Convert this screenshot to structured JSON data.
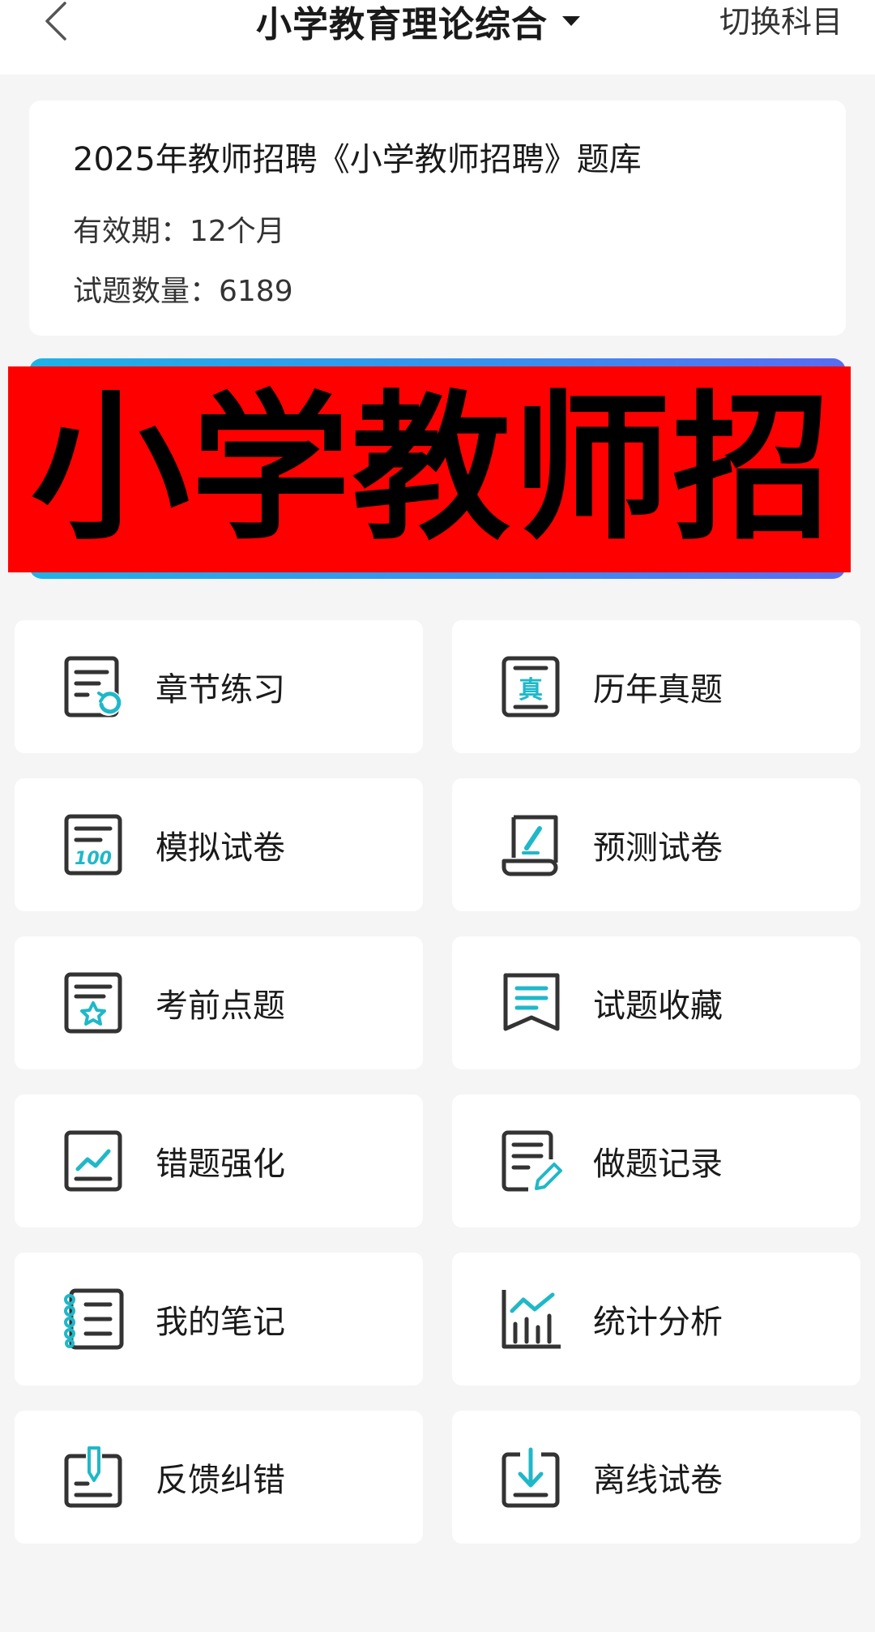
{
  "header": {
    "back_icon": "chevron-left-icon",
    "title": "小学教育理论综合",
    "dropdown_icon": "caret-down-icon",
    "switch_label": "切换科目"
  },
  "info_card": {
    "title": "2025年教师招聘《小学教师招聘》题库",
    "validity": "有效期：12个月",
    "question_count": "试题数量：6189"
  },
  "banner": {
    "text": "小学教师招",
    "colors": {
      "overlay": "#ff0000",
      "gradient_start": "#1fb2e6",
      "gradient_end": "#5a6cf2"
    }
  },
  "colors": {
    "accent": "#1fb8c9",
    "icon_stroke": "#333333",
    "tile_background": "#ffffff",
    "page_background": "#f5f5f5"
  },
  "menu": {
    "items": [
      {
        "label": "章节练习",
        "icon": "chapter-practice-icon"
      },
      {
        "label": "历年真题",
        "icon": "past-exams-icon"
      },
      {
        "label": "模拟试卷",
        "icon": "mock-paper-icon"
      },
      {
        "label": "预测试卷",
        "icon": "forecast-paper-icon"
      },
      {
        "label": "考前点题",
        "icon": "pre-exam-tips-icon"
      },
      {
        "label": "试题收藏",
        "icon": "bookmark-icon"
      },
      {
        "label": "错题强化",
        "icon": "wrong-questions-icon"
      },
      {
        "label": "做题记录",
        "icon": "practice-record-icon"
      },
      {
        "label": "我的笔记",
        "icon": "notes-icon"
      },
      {
        "label": "统计分析",
        "icon": "statistics-icon"
      },
      {
        "label": "反馈纠错",
        "icon": "feedback-icon"
      },
      {
        "label": "离线试卷",
        "icon": "offline-download-icon"
      }
    ]
  }
}
